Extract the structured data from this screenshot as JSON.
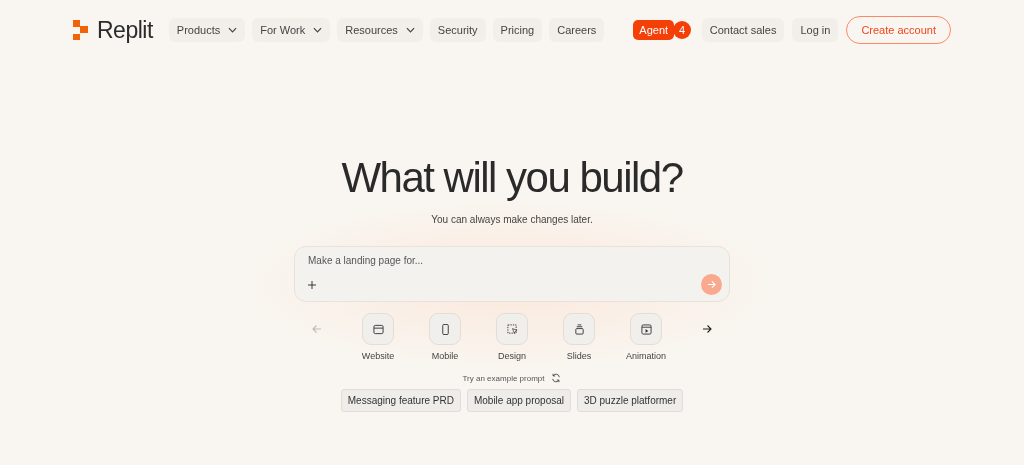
{
  "logo": {
    "name": "Replit"
  },
  "nav": [
    {
      "label": "Products",
      "kind": "dropdown"
    },
    {
      "label": "For Work",
      "kind": "dropdown"
    },
    {
      "label": "Resources",
      "kind": "dropdown"
    },
    {
      "label": "Security",
      "kind": "link"
    },
    {
      "label": "Pricing",
      "kind": "link"
    },
    {
      "label": "Careers",
      "kind": "link"
    },
    {
      "label": "Agent",
      "kind": "badge",
      "badge": "4"
    }
  ],
  "actions": [
    {
      "label": "Contact sales",
      "kind": "link"
    },
    {
      "label": "Log in",
      "kind": "link"
    },
    {
      "label": "Create account",
      "kind": "outline"
    }
  ],
  "hero": {
    "title": "What will you build?",
    "subtitle": "You can always make changes later."
  },
  "prompt": {
    "placeholder": "Make a landing page for..."
  },
  "carousel": {
    "prev_disabled": true,
    "next_disabled": false
  },
  "categories": [
    {
      "label": "Website",
      "kind": "website"
    },
    {
      "label": "Mobile",
      "kind": "mobile"
    },
    {
      "label": "Design",
      "kind": "design"
    },
    {
      "label": "Slides",
      "kind": "slides"
    },
    {
      "label": "Animation",
      "kind": "animation"
    }
  ],
  "examples": {
    "label": "Try an example prompt",
    "chips": [
      "Messaging feature PRD",
      "Mobile app proposal",
      "3D puzzle platformer"
    ]
  }
}
